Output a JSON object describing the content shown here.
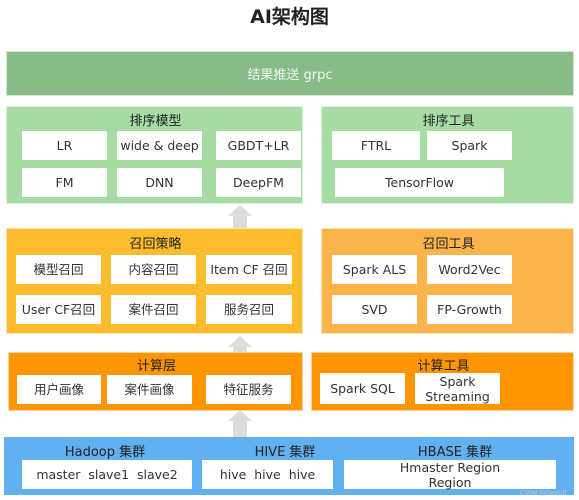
{
  "title": "AI架构图",
  "push_layer": {
    "label": "结果推送 grpc",
    "color": "#87bb87"
  },
  "ranking_models": {
    "title": "排序模型",
    "color": "#a7dca5",
    "items": [
      "LR",
      "wide & deep",
      "GBDT+LR",
      "FM",
      "DNN",
      "DeepFM"
    ]
  },
  "ranking_tools": {
    "title": "排序工具",
    "color": "#a7dca5",
    "items": [
      "FTRL",
      "Spark",
      "TensorFlow"
    ]
  },
  "recall_strategy": {
    "title": "召回策略",
    "color": "#fbbd2e",
    "items": [
      "模型召回",
      "内容召回",
      "Item CF 召回",
      "User CF召回",
      "案件召回",
      "服务召回"
    ]
  },
  "recall_tools": {
    "title": "召回工具",
    "color": "#fbb44b",
    "items": [
      "Spark ALS",
      "Word2Vec",
      "SVD",
      "FP-Growth"
    ]
  },
  "compute_layer": {
    "title": "计算层",
    "color": "#ff9600",
    "items": [
      "用户画像",
      "案件画像",
      "特征服务"
    ]
  },
  "compute_tools": {
    "title": "计算工具",
    "color": "#ff9600",
    "items": [
      "Spark SQL",
      "Spark\nStreaming"
    ]
  },
  "clusters": {
    "color": "#61b1f1",
    "groups": [
      {
        "title": "Hadoop 集群",
        "content": "master  slave1  slave2"
      },
      {
        "title": "HIVE 集群",
        "content": "hive  hive  hive"
      },
      {
        "title": "HBASE 集群",
        "content": "Hmaster  Region\nRegion"
      }
    ]
  },
  "arrows": {
    "icon": "up-arrow-icon",
    "color": "#dcdcdc"
  },
  "watermark": "CSDN @GeoJeff"
}
